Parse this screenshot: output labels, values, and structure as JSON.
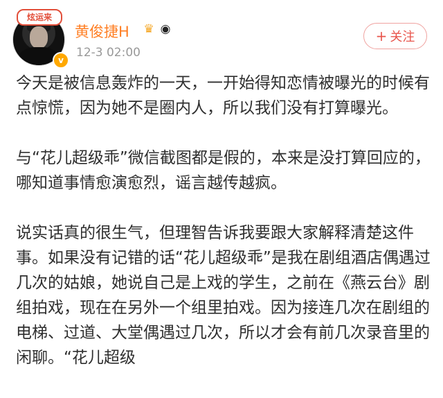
{
  "post": {
    "author": {
      "name": "黄俊捷H",
      "avatar_banner": "炫运来",
      "verified_icon": "v-badge-icon",
      "badge_icons": [
        "crown-icon",
        "panda-icon"
      ]
    },
    "timestamp": "12-3 02:00",
    "follow_label": "关注",
    "follow_icon": "plus-icon",
    "paragraphs": [
      "今天是被信息轰炸的一天，一开始得知恋情被曝光的时候有点惊慌，因为她不是圈内人，所以我们没有打算曝光。",
      "与“花儿超级乖”微信截图都是假的，本来是没打算回应的，哪知道事情愈演愈烈，谣言越传越疯。",
      "说实话真的很生气，但理智告诉我要跟大家解释清楚这件事。如果没有记错的话“花儿超级乖”是我在剧组酒店偶遇过几次的姑娘，她说自己是上戏的学生，之前在《燕云台》剧组拍戏，现在在另外一个组里拍戏。因为接连几次在剧组的电梯、过道、大堂偶遇过几次，所以才会有前几次录音里的闲聊。“花儿超级"
    ]
  }
}
